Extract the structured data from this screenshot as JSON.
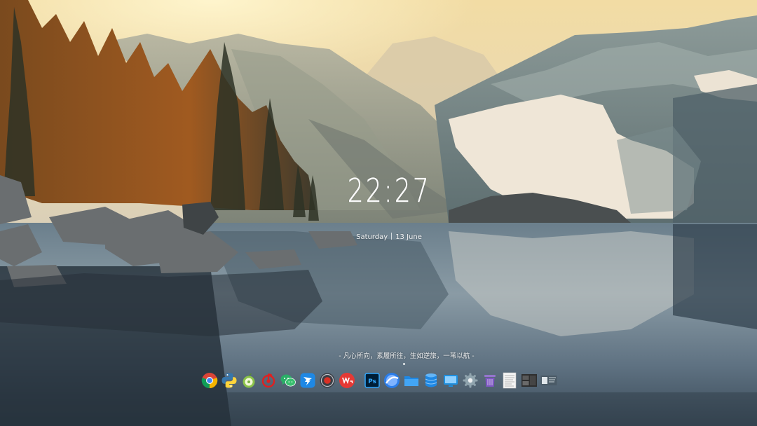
{
  "desktop": {
    "clock_time": "22:27",
    "date_weekday": "Saturday",
    "date_day": "13 June",
    "quote": "- 凡心所向，素履所往，生如逆旅，一苇以航 -"
  },
  "dock": {
    "icons": [
      {
        "name": "chrome-icon",
        "color": "#1a73e8"
      },
      {
        "name": "python-icon",
        "color": "#3776ab"
      },
      {
        "name": "apple-fruit-icon",
        "color": "#7cc142"
      },
      {
        "name": "netease-music-icon",
        "color": "#e02020"
      },
      {
        "name": "wechat-icon",
        "color": "#2aae67"
      },
      {
        "name": "dingtalk-icon",
        "color": "#1e88e5"
      },
      {
        "name": "record-icon",
        "color": "#d93025"
      },
      {
        "name": "wps-icon",
        "color": "#e53935"
      },
      {
        "name": "photoshop-icon",
        "color": "#31a8ff"
      },
      {
        "name": "browser-globe-icon",
        "color": "#2b7de9"
      },
      {
        "name": "folder-icon",
        "color": "#29a3f0"
      },
      {
        "name": "database-icon",
        "color": "#2196f3"
      },
      {
        "name": "monitor-icon",
        "color": "#1e90e0"
      },
      {
        "name": "settings-icon",
        "color": "#78909c"
      },
      {
        "name": "trash-icon",
        "color": "#7e57c2"
      },
      {
        "name": "document-thumbnail-icon",
        "color": "#e8e8e8"
      },
      {
        "name": "video-thumbnail-icon",
        "color": "#3a3a3a"
      },
      {
        "name": "screenshot-thumbnail-icon",
        "color": "#5a6d7a"
      }
    ]
  }
}
